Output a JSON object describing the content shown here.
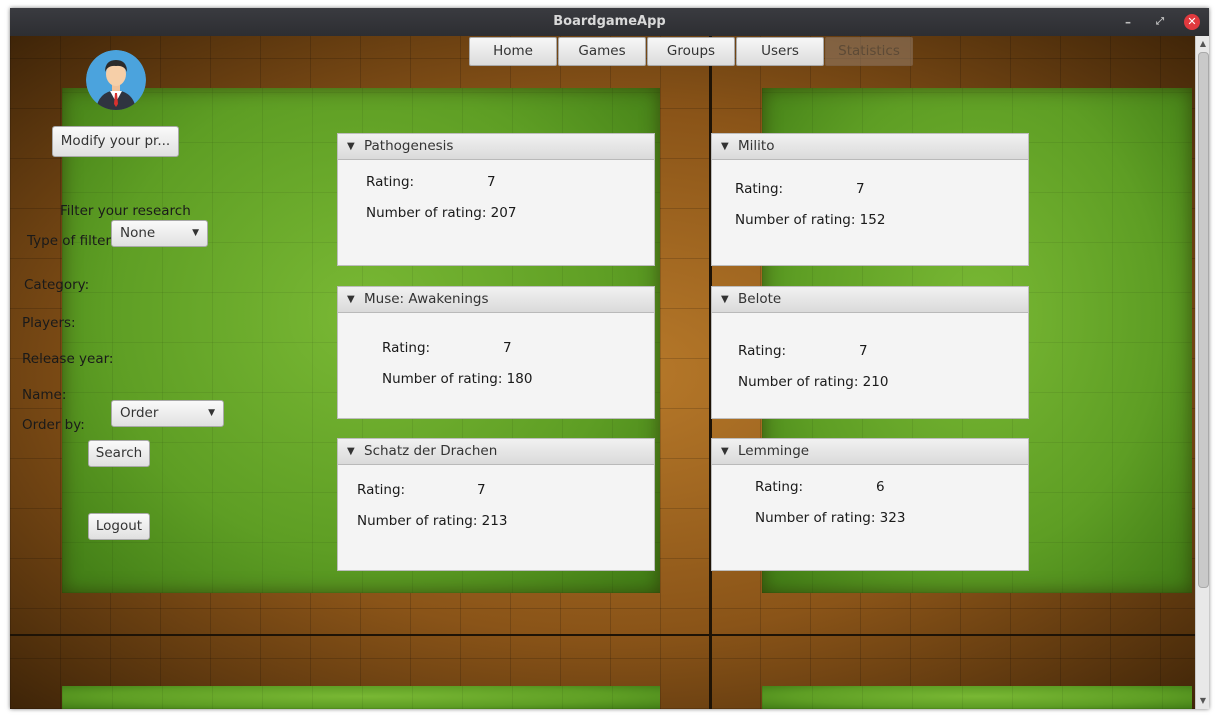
{
  "window": {
    "title": "BoardgameApp",
    "controls": {
      "minimize": "–",
      "maximize": "⤢",
      "close": "✕"
    }
  },
  "nav": {
    "home": "Home",
    "games": "Games",
    "groups": "Groups",
    "users": "Users",
    "statistics": "Statistics"
  },
  "sidebar": {
    "modify_button": "Modify your pr...",
    "filter_title": "Filter your research",
    "type_of_filter_label": "Type of filter",
    "type_of_filter_value": "None",
    "category_label": "Category:",
    "players_label": "Players:",
    "release_year_label": "Release year:",
    "name_label": "Name:",
    "order_by_label": "Order by:",
    "order_by_value": "Order",
    "search_button": "Search",
    "logout_button": "Logout"
  },
  "cards": [
    {
      "title": "Pathogenesis",
      "rating_label": "Rating:",
      "rating": "7",
      "count_label": "Number of rating:",
      "count": "207"
    },
    {
      "title": "Milito",
      "rating_label": "Rating:",
      "rating": "7",
      "count_label": "Number of rating:",
      "count": "152"
    },
    {
      "title": "Muse: Awakenings",
      "rating_label": "Rating:",
      "rating": "7",
      "count_label": "Number of rating:",
      "count": "180"
    },
    {
      "title": "Belote",
      "rating_label": "Rating:",
      "rating": "7",
      "count_label": "Number of rating:",
      "count": "210"
    },
    {
      "title": "Schatz der Drachen",
      "rating_label": "Rating:",
      "rating": "7",
      "count_label": "Number of rating:",
      "count": "213"
    },
    {
      "title": "Lemminge",
      "rating_label": "Rating:",
      "rating": "6",
      "count_label": "Number of rating:",
      "count": "323"
    }
  ],
  "colors": {
    "accent_close": "#e0393e",
    "active_tab": "#967d69",
    "grass": "#5e9e24",
    "wood": "#8a5418"
  },
  "icons": {
    "expand": "triangle-down-icon",
    "dropdown": "chevron-down-icon",
    "avatar": "user-avatar-icon"
  }
}
